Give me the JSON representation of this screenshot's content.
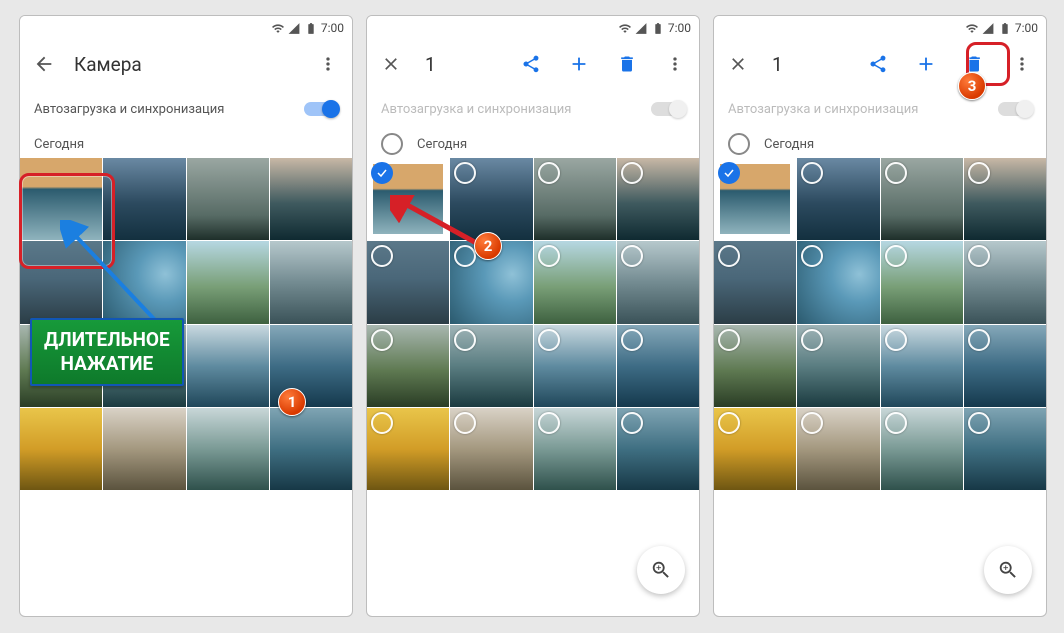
{
  "status": {
    "time": "7:00"
  },
  "screen1": {
    "title": "Камера",
    "sync_label": "Автозагрузка и синхронизация",
    "sync_on": true,
    "section": "Сегодня"
  },
  "screen2": {
    "count": "1",
    "sync_label": "Автозагрузка и синхронизация",
    "section": "Сегодня"
  },
  "screen3": {
    "count": "1",
    "sync_label": "Автозагрузка и синхронизация",
    "section": "Сегодня"
  },
  "annot": {
    "hint_text": "ДЛИТЕЛЬНОЕ\nНАЖАТИЕ",
    "badge1": "1",
    "badge2": "2",
    "badge3": "3"
  },
  "colors": {
    "accent": "#1a73e8",
    "badge": "#e84a0f",
    "hint_border": "#1156b5",
    "red": "#d62027"
  }
}
